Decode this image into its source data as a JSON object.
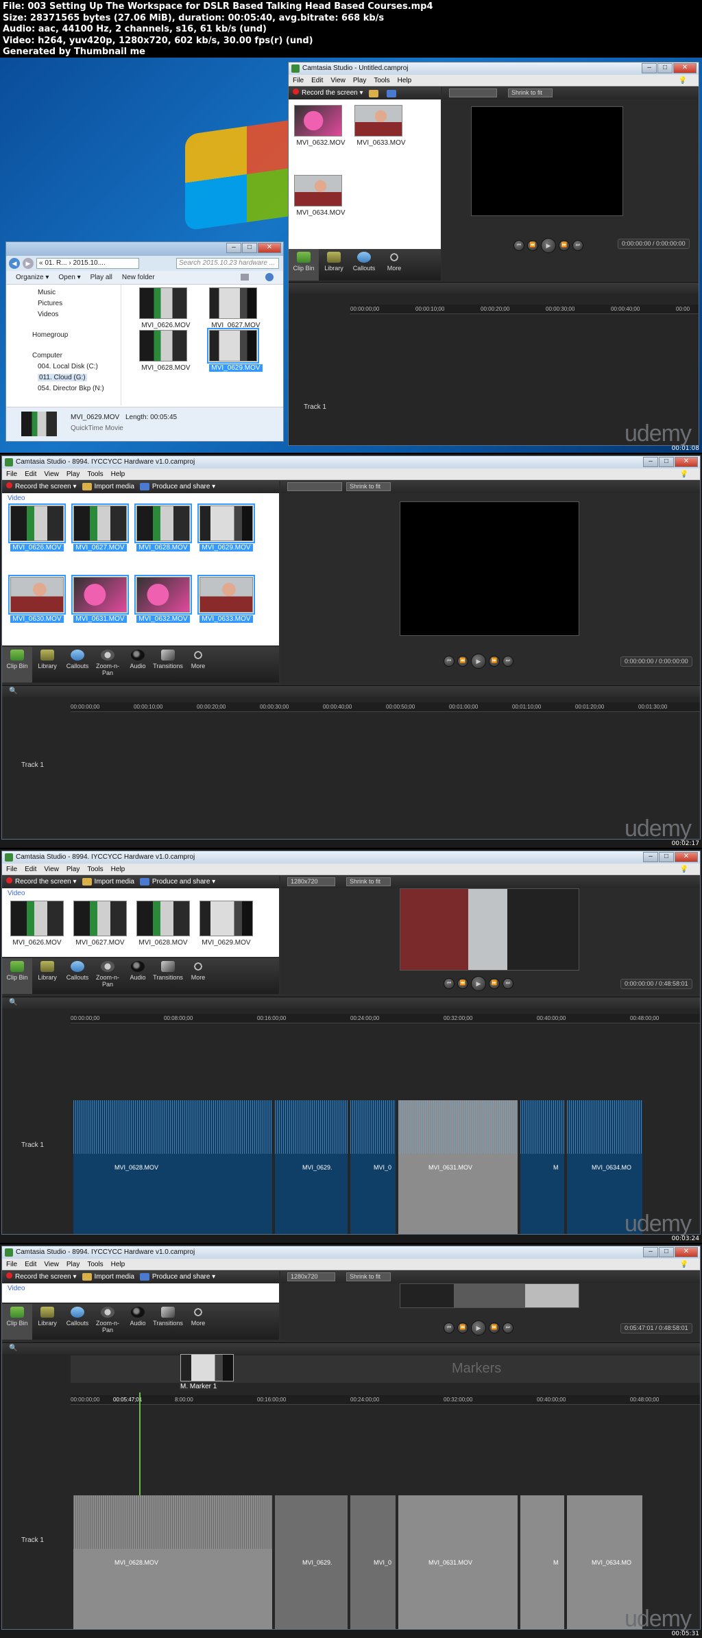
{
  "header": {
    "line1": "File: 003 Setting Up The Workspace for DSLR Based Talking Head Based Courses.mp4",
    "line2": "Size: 28371565 bytes (27.06 MiB), duration: 00:05:40, avg.bitrate: 668 kb/s",
    "line3": "Audio: aac, 44100 Hz, 2 channels, s16, 61 kb/s (und)",
    "line4": "Video: h264, yuv420p, 1280x720, 602 kb/s, 30.00 fps(r) (und)",
    "line5": "Generated by Thumbnail me"
  },
  "watermark": "udemy",
  "menu": [
    "File",
    "Edit",
    "View",
    "Play",
    "Tools",
    "Help"
  ],
  "tabs": [
    "Clip Bin",
    "Library",
    "Callouts",
    "Zoom-n-Pan",
    "Audio",
    "Transitions",
    "More"
  ],
  "frame1": {
    "timestamp": "00:01:08",
    "title": "Camtasia Studio - Untitled.camproj",
    "record": "Record the screen",
    "shrink": "Shrink to fit",
    "clips": [
      "MVI_0632.MOV",
      "MVI_0633.MOV",
      "MVI_0634.MOV"
    ],
    "tabs": [
      "Clip Bin",
      "Library",
      "Callouts",
      "More"
    ],
    "timecode": "0:00:00:00 / 0:00:00:00",
    "ruler": [
      "00:00:00;00",
      "00:00:10;00",
      "00:00:20;00",
      "00:00:30;00",
      "00:00:40;00",
      "00:00"
    ],
    "track": "Track 1",
    "explorer": {
      "path": "« 01. R... › 2015.10....",
      "search": "Search 2015.10.23 hardware ...",
      "organize": "Organize ▾",
      "open": "Open ▾",
      "playall": "Play all",
      "newfolder": "New folder",
      "nav": [
        "Music",
        "Pictures",
        "Videos",
        "Homegroup",
        "Computer",
        "004. Local Disk (C:)",
        "011. Cloud (G:)",
        "054. Director Bkp (N:)"
      ],
      "files": [
        "MVI_0626.MOV",
        "MVI_0627.MOV",
        "MVI_0628.MOV",
        "MVI_0629.MOV"
      ],
      "status_name": "MVI_0629.MOV",
      "status_length": "Length: 00:05:45",
      "status_type": "QuickTime Movie"
    }
  },
  "frame2": {
    "timestamp": "00:02:17",
    "title": "Camtasia Studio - 8994. IYCCYCC Hardware v1.0.camproj",
    "record": "Record the screen",
    "import": "Import media",
    "produce": "Produce and share",
    "shrink": "Shrink to fit",
    "group": "Video",
    "clips": [
      "MVI_0626.MOV",
      "MVI_0627.MOV",
      "MVI_0628.MOV",
      "MVI_0629.MOV",
      "MVI_0630.MOV",
      "MVI_0631.MOV",
      "MVI_0632.MOV",
      "MVI_0633.MOV"
    ],
    "timecode": "0:00:00:00 / 0:00:00:00",
    "ruler": [
      "00:00:00;00",
      "00:00:10;00",
      "00:00:20;00",
      "00:00:30;00",
      "00:00:40;00",
      "00:00:50;00",
      "00:01:00;00",
      "00:01:10;00",
      "00:01:20;00",
      "00:01:30;00"
    ],
    "track": "Track 1"
  },
  "frame3": {
    "timestamp": "00:03:24",
    "title": "Camtasia Studio - 8994. IYCCYCC Hardware v1.0.camproj",
    "record": "Record the screen",
    "import": "Import media",
    "produce": "Produce and share",
    "res": "1280x720",
    "shrink": "Shrink to fit",
    "group": "Video",
    "clips": [
      "MVI_0626.MOV",
      "MVI_0627.MOV",
      "MVI_0628.MOV",
      "MVI_0629.MOV"
    ],
    "timecode": "0:00:00:00 / 0:48:58:01",
    "ruler": [
      "00:00:00;00",
      "00:08:00;00",
      "00:16:00;00",
      "00:24:00;00",
      "00:32:00;00",
      "00:40:00;00",
      "00:48:00;00"
    ],
    "track": "Track 1",
    "timeline_clips": [
      "MVI_0628.MOV",
      "MVI_0629.",
      "MVI_0",
      "MVI_0631.MOV",
      "M",
      "MVI_0634.MO"
    ]
  },
  "frame4": {
    "timestamp": "00:05:31",
    "title": "Camtasia Studio - 8994. IYCCYCC Hardware v1.0.camproj",
    "record": "Record the screen",
    "import": "Import media",
    "produce": "Produce and share",
    "res": "1280x720",
    "shrink": "Shrink to fit",
    "group": "Video",
    "timecode": "0:05:47:01 / 0:48:58:01",
    "ruler": [
      "00:00:00;00",
      "00:05:47;01",
      "8:00:00",
      "00:16:00;00",
      "00:24:00;00",
      "00:32:00;00",
      "00:40:00;00",
      "00:48:00;00"
    ],
    "marker_label": "M. Marker 1",
    "markers_title": "Markers",
    "track": "Track 1",
    "timeline_clips": [
      "MVI_0628.MOV",
      "MVI_0629.",
      "MVI_0",
      "MVI_0631.MOV",
      "M",
      "MVI_0634.MO"
    ]
  }
}
